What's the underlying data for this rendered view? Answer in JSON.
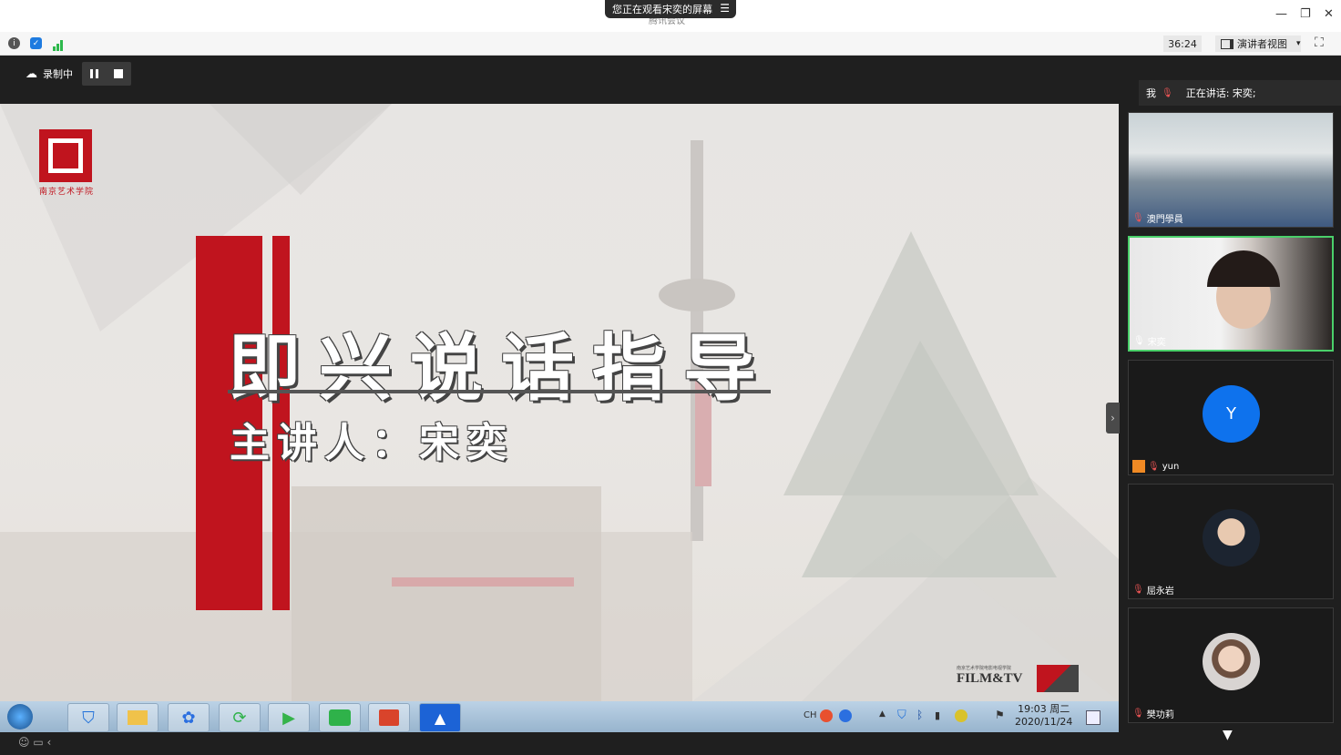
{
  "window": {
    "share_banner": "您正在观看宋奕的屏幕",
    "app_title": "腾讯会议",
    "minimize": "—",
    "restore": "❐",
    "close": "✕"
  },
  "toolbar": {
    "timer": "36:24",
    "view_label": "演讲者视图",
    "view_caret": "▾"
  },
  "recording": {
    "label": "录制中"
  },
  "slide": {
    "title": "即兴说话指导",
    "subtitle": "主讲人：宋奕",
    "school_logo_text": "南京艺术学院",
    "film_logo_text": "FILM&TV",
    "film_logo_small": "南京艺术学院电影电视学院"
  },
  "taskbar": {
    "tray_lang": "CH",
    "clock_time": "19:03 周二",
    "clock_date": "2020/11/24"
  },
  "sidebar": {
    "me_label": "我",
    "speaking_label": "正在讲话: 宋奕;",
    "participants": [
      {
        "name": "澳門學員"
      },
      {
        "name": "宋奕"
      },
      {
        "name": "yun",
        "avatar_letter": "Y",
        "avatar_color": "#0e72ed"
      },
      {
        "name": "屈永岩"
      },
      {
        "name": "樊功莉"
      }
    ]
  },
  "colors": {
    "accent_red": "#c0141e",
    "active_border": "#4ad06a",
    "avatar_blue": "#0e72ed"
  }
}
